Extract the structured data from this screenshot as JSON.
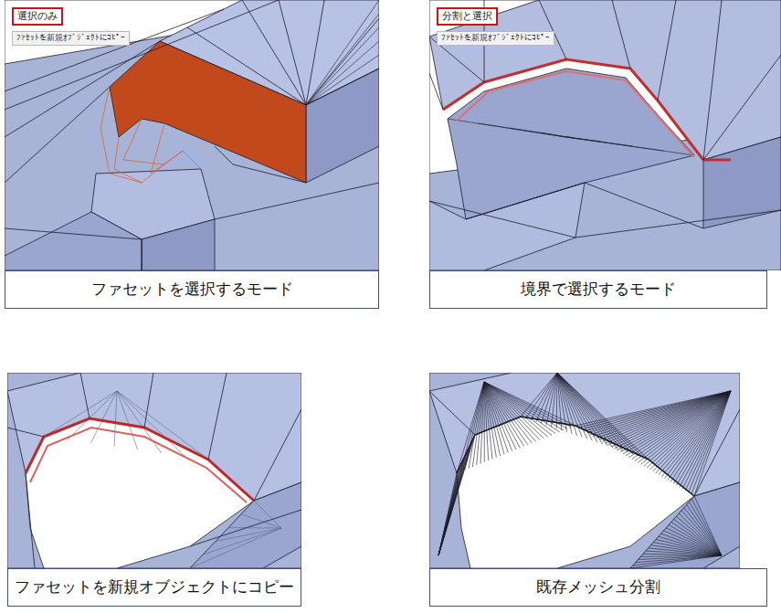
{
  "panels": [
    {
      "kind": "select",
      "mode_label": "選択のみ",
      "tooltip": "ﾌｧｾｯﾄを新規ｵﾌﾞｼﾞｪｸﾄにｺﾋﾟｰ",
      "caption": "ファセットを選択するモード"
    },
    {
      "kind": "boundary",
      "mode_label": "分割と選択",
      "tooltip": "ﾌｧｾｯﾄを新規ｵﾌﾞｼﾞｪｸﾄにｺﾋﾟｰ",
      "caption": "境界で選択するモード"
    },
    {
      "kind": "copy",
      "caption": "ファセットを新規オブジェクトにコピー"
    },
    {
      "kind": "split",
      "caption": "既存メッシュ分割"
    }
  ]
}
